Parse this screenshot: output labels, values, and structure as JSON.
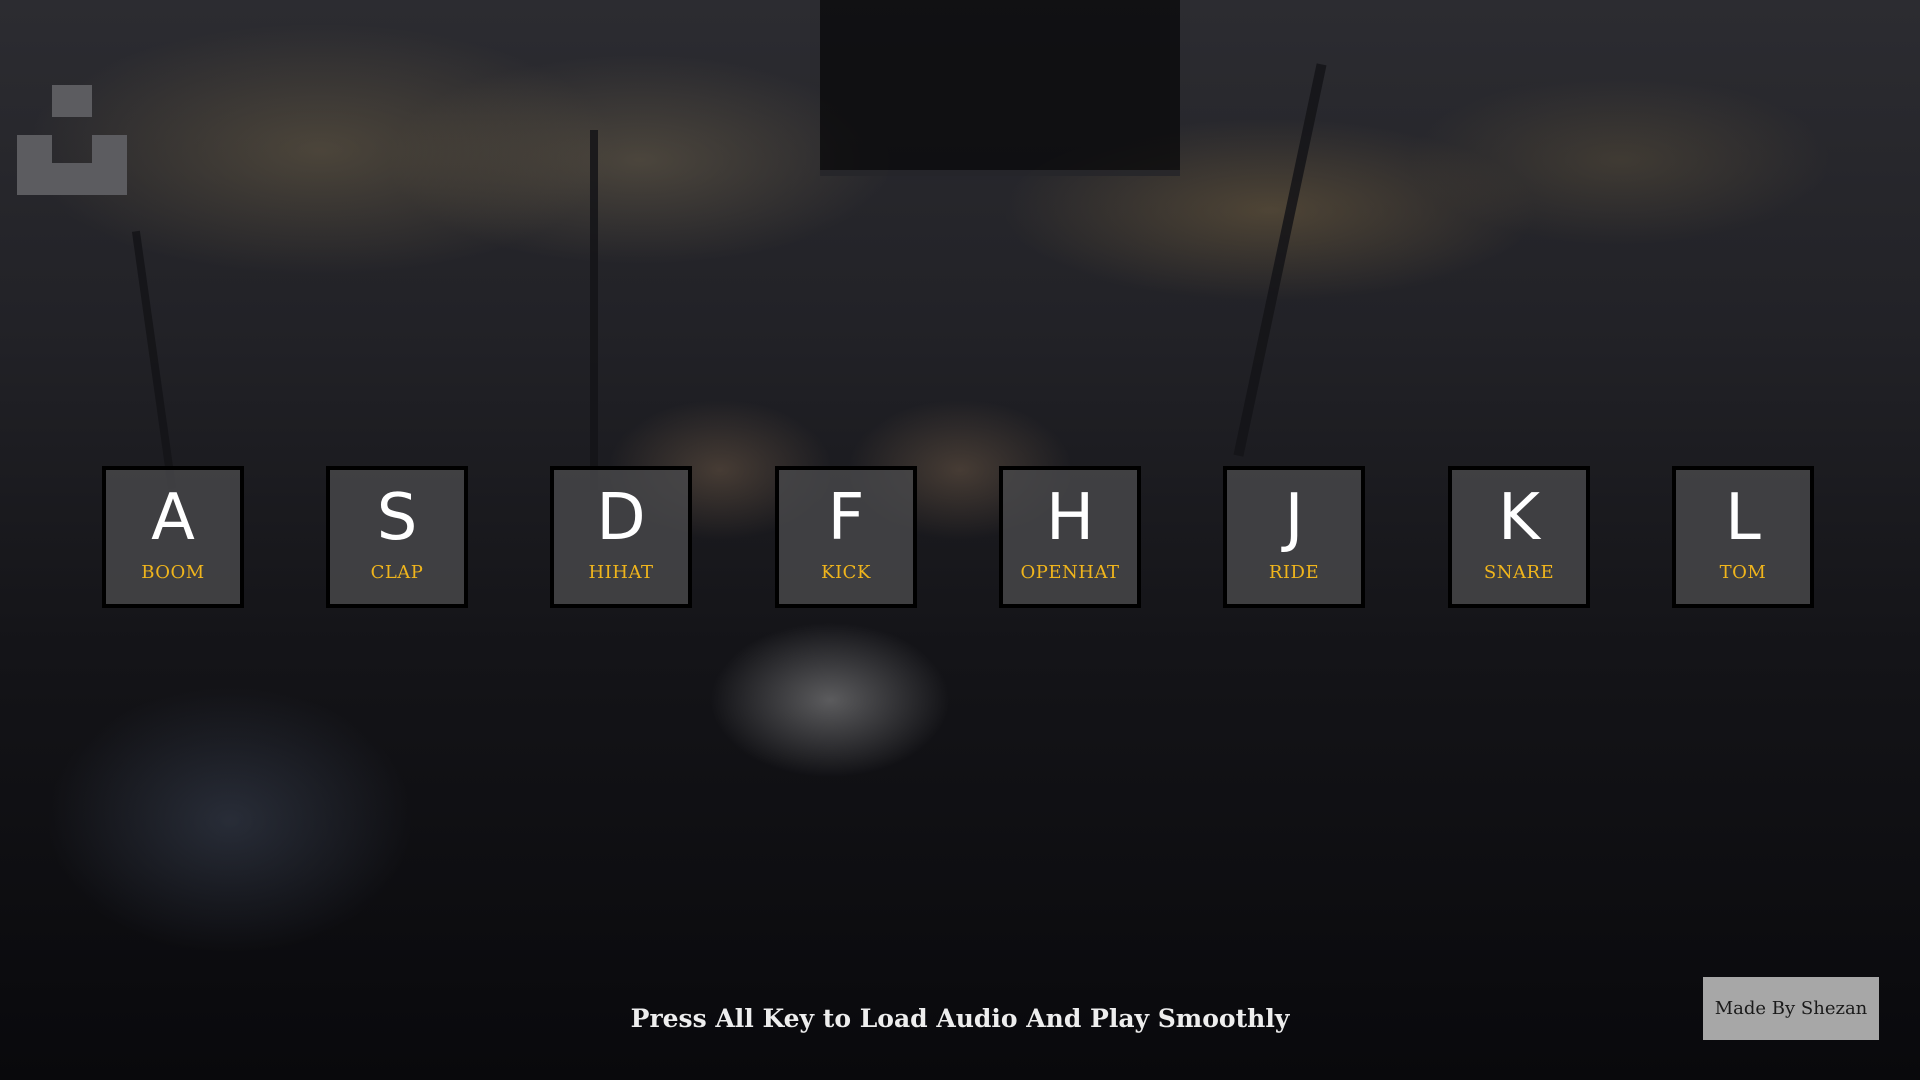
{
  "keys": [
    {
      "letter": "A",
      "sound": "BOOM"
    },
    {
      "letter": "S",
      "sound": "CLAP"
    },
    {
      "letter": "D",
      "sound": "HIHAT"
    },
    {
      "letter": "F",
      "sound": "KICK"
    },
    {
      "letter": "H",
      "sound": "OPENHAT"
    },
    {
      "letter": "J",
      "sound": "RIDE"
    },
    {
      "letter": "K",
      "sound": "SNARE"
    },
    {
      "letter": "L",
      "sound": "TOM"
    }
  ],
  "hint": "Press All Key to Load Audio And Play Smoothly",
  "credit": "Made By Shezan",
  "colors": {
    "letter": "#ffffff",
    "sound_label": "#f0b51c",
    "key_background": "#48484a",
    "key_border": "#000000",
    "credit_background": "#a7a7a7"
  },
  "icons": {
    "logo": "bookmarklet-logo-icon"
  }
}
